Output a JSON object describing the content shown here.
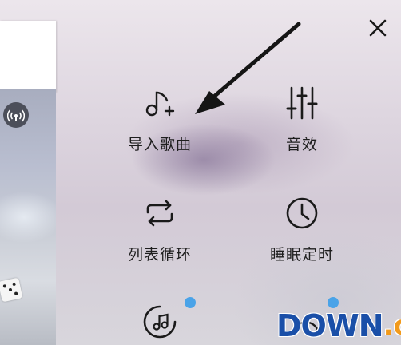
{
  "close_icon": "close-icon",
  "menu": {
    "items": [
      {
        "label": "导入歌曲",
        "icon": "music-note-add-icon"
      },
      {
        "label": "音效",
        "icon": "equalizer-icon"
      },
      {
        "label": "列表循环",
        "icon": "repeat-icon"
      },
      {
        "label": "睡眠定时",
        "icon": "clock-icon"
      },
      {
        "label": "",
        "icon": "music-disc-icon"
      },
      {
        "label": "",
        "icon": "partially-hidden-icon"
      }
    ]
  },
  "background": {
    "left_panel_icons": [
      "hotspot-icon",
      "dice-icon"
    ]
  },
  "watermark": {
    "main": "DOWN",
    "sub": ".cc"
  },
  "colors": {
    "badge": "#4aa3e8",
    "watermark_blue": "#1a4fa8",
    "watermark_orange": "#f29a1b",
    "text": "#1e1e1e"
  }
}
